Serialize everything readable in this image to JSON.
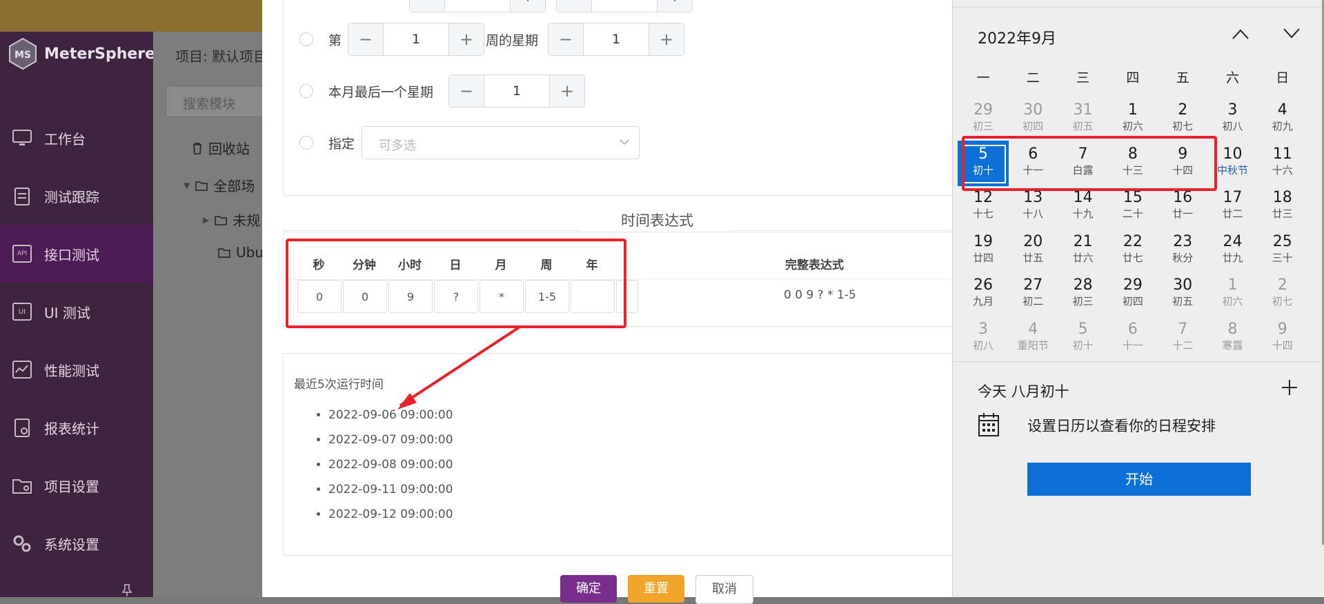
{
  "app": {
    "logo_text": "MeterSphere",
    "brand_color": "#7a2e8c"
  },
  "sidebar": {
    "items": [
      {
        "label": "工作台",
        "icon": "monitor-icon"
      },
      {
        "label": "测试跟踪",
        "icon": "clipboard-icon"
      },
      {
        "label": "接口测试",
        "icon": "api-icon",
        "active": true
      },
      {
        "label": "UI 测试",
        "icon": "ui-icon"
      },
      {
        "label": "性能测试",
        "icon": "performance-icon"
      },
      {
        "label": "报表统计",
        "icon": "report-icon"
      },
      {
        "label": "项目设置",
        "icon": "folder-gear-icon"
      },
      {
        "label": "系统设置",
        "icon": "gears-icon"
      }
    ]
  },
  "background": {
    "project_label": "项目: 默认项目",
    "search_placeholder": "搜索模块",
    "recycle": "回收站",
    "tree_all": "全部场",
    "tree_unplanned": "未规",
    "tree_ubu": "Ubu"
  },
  "dialog": {
    "options": {
      "week_of": {
        "prefix": "第",
        "week_value": "1",
        "middle": "周的星期",
        "day_value": "1"
      },
      "last_week": {
        "label": "本月最后一个星期",
        "value": "1"
      },
      "specify": {
        "label": "指定",
        "placeholder": "可多选"
      }
    },
    "section_title": "时间表达式",
    "columns": [
      "秒",
      "分钟",
      "小时",
      "日",
      "月",
      "周",
      "年"
    ],
    "values": [
      "0",
      "0",
      "9",
      "?",
      "*",
      "1-5",
      ""
    ],
    "full_expression_header": "完整表达式",
    "full_expression": "0 0 9 ? * 1-5",
    "recent_runs_title": "最近5次运行时间",
    "recent_runs": [
      "2022-09-06 09:00:00",
      "2022-09-07 09:00:00",
      "2022-09-08 09:00:00",
      "2022-09-11 09:00:00",
      "2022-09-12 09:00:00"
    ],
    "buttons": {
      "ok": "确定",
      "reset": "重置",
      "cancel": "取消"
    }
  },
  "calendar": {
    "month_title": "2022年9月",
    "weekdays": [
      "一",
      "二",
      "三",
      "四",
      "五",
      "六",
      "日"
    ],
    "weeks": [
      [
        {
          "n": "29",
          "l": "初三",
          "o": 1
        },
        {
          "n": "30",
          "l": "初四",
          "o": 1
        },
        {
          "n": "31",
          "l": "初五",
          "o": 1
        },
        {
          "n": "1",
          "l": "初六"
        },
        {
          "n": "2",
          "l": "初七"
        },
        {
          "n": "3",
          "l": "初八"
        },
        {
          "n": "4",
          "l": "初九"
        }
      ],
      [
        {
          "n": "5",
          "l": "初十",
          "t": 1
        },
        {
          "n": "6",
          "l": "十一"
        },
        {
          "n": "7",
          "l": "白露"
        },
        {
          "n": "8",
          "l": "十三"
        },
        {
          "n": "9",
          "l": "十四"
        },
        {
          "n": "10",
          "l": "中秋节",
          "f": 1
        },
        {
          "n": "11",
          "l": "十六"
        }
      ],
      [
        {
          "n": "12",
          "l": "十七"
        },
        {
          "n": "13",
          "l": "十八"
        },
        {
          "n": "14",
          "l": "十九"
        },
        {
          "n": "15",
          "l": "二十"
        },
        {
          "n": "16",
          "l": "廿一"
        },
        {
          "n": "17",
          "l": "廿二"
        },
        {
          "n": "18",
          "l": "廿三"
        }
      ],
      [
        {
          "n": "19",
          "l": "廿四"
        },
        {
          "n": "20",
          "l": "廿五"
        },
        {
          "n": "21",
          "l": "廿六"
        },
        {
          "n": "22",
          "l": "廿七"
        },
        {
          "n": "23",
          "l": "秋分"
        },
        {
          "n": "24",
          "l": "廿九"
        },
        {
          "n": "25",
          "l": "三十"
        }
      ],
      [
        {
          "n": "26",
          "l": "九月"
        },
        {
          "n": "27",
          "l": "初二"
        },
        {
          "n": "28",
          "l": "初三"
        },
        {
          "n": "29",
          "l": "初四"
        },
        {
          "n": "30",
          "l": "初五"
        },
        {
          "n": "1",
          "l": "初六",
          "o": 1
        },
        {
          "n": "2",
          "l": "初七",
          "o": 1
        }
      ],
      [
        {
          "n": "3",
          "l": "初八",
          "o": 1
        },
        {
          "n": "4",
          "l": "重阳节",
          "o": 1
        },
        {
          "n": "5",
          "l": "初十",
          "o": 1
        },
        {
          "n": "6",
          "l": "十一",
          "o": 1
        },
        {
          "n": "7",
          "l": "十二",
          "o": 1
        },
        {
          "n": "8",
          "l": "寒露",
          "o": 1
        },
        {
          "n": "9",
          "l": "十四",
          "o": 1
        }
      ]
    ],
    "today_label": "今天 八月初十",
    "empty_message": "设置日历以查看你的日程安排",
    "start_button": "开始",
    "accent_color": "#0c6fd6",
    "highlight_color": "#e8212a"
  }
}
